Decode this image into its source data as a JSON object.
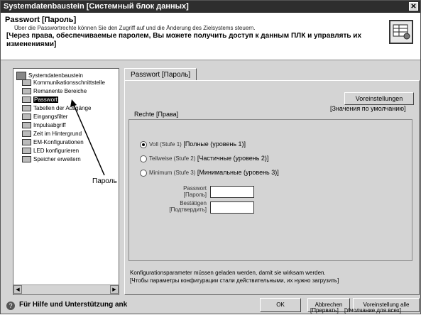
{
  "title": "Systemdatenbaustein [Системный блок данных]",
  "header": {
    "heading": "Passwort [Пароль]",
    "german_desc": "Über die Passwortrechte können Sie den Zugriff auf und die Änderung des Zielsystems steuern.",
    "russian_desc": "[Через права, обеспечиваемые паролем, Вы можете получить доступ к данным ПЛК и управлять их изменениями]"
  },
  "tree": {
    "root": "Systemdatenbaustein",
    "items": [
      "Kommunikationsschnittstelle",
      "Remanente Bereiche",
      "Passwort",
      "Tabellen der Ausgänge",
      "Eingangsfilter",
      "Impulsabgriff",
      "Zeit im Hintergrund",
      "EM-Konfigurationen",
      "LED konfigurieren",
      "Speicher erweitern"
    ],
    "callout": "Пароль"
  },
  "tab": {
    "label": "Passwort [Пароль]"
  },
  "defaults": {
    "button": "Voreinstellungen",
    "caption": "[Значения по умолчанию]"
  },
  "rights": {
    "label": "Rechte [Права]",
    "options": [
      {
        "de": "Voll (Stufe 1)",
        "ru": "[Полные (уровень 1)]"
      },
      {
        "de": "Teilweise (Stufe 2)",
        "ru": "[Частичные (уровень 2)]"
      },
      {
        "de": "Minimum (Stufe 3)",
        "ru": "[Минимальные (уровень 3)]"
      }
    ],
    "selected": 0
  },
  "fields": {
    "password_de": "Passwort",
    "password_ru": "[Пароль]",
    "confirm_de": "Bestätigen",
    "confirm_ru": "[Подтвердить]"
  },
  "note": {
    "de": "Konfigurationsparameter müssen geladen werden, damit sie wirksam werden.",
    "ru": "[Чтобы параметры конфигурации стали действительными, их нужно загрузить]"
  },
  "footer": {
    "help": "Für Hilfe und Unterstützung ank",
    "ok": "OK",
    "cancel": "Abbrechen",
    "cancel_ru": "[Прервать]",
    "defaults_all": "Voreinstellung alle",
    "defaults_all_ru": "[Умолчание для всех]"
  }
}
